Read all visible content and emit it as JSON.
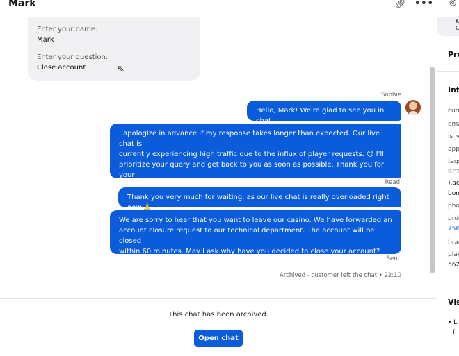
{
  "header": {
    "title": "Mark",
    "link_icon": "link-icon",
    "more_icon": "more-icon"
  },
  "form": {
    "name_label": "Enter your name:",
    "name_value": "Mark",
    "question_label": "Enter your question:",
    "question_value": "Close account"
  },
  "messages": {
    "sender": "Sophie",
    "m1": "Hello, Mark! We're glad to see you in chat.",
    "m2": "I apologize in advance if my response takes longer than expected. Our live chat is\ncurrently experiencing high traffic due to the influx of player requests. 😊 I'll\nprioritize your query and get back to you as soon as possible. Thank you for your\npatience! 😊",
    "read_status": "Read",
    "m3": "Thank you very much for waiting, as our live chat is really overloaded right now.🙏",
    "m4": "We are sorry to hear that you want to leave our casino. We have forwarded an\naccount closure request to our technical department. The account will be closed\nwithin 60 minutes. May I ask why have you decided to close your account?",
    "sent_status": "Sent",
    "archived_note": "Archived - customer left the chat • 22:10"
  },
  "footer": {
    "archived_text": "This chat has been archived.",
    "open_button": "Open chat"
  },
  "sidebar": {
    "card_line1": "K",
    "card_line2": "C",
    "pre_heading": "Pre",
    "inte_heading": "Inte",
    "fields": [
      "curr",
      "ema",
      "is_v",
      "app",
      "tags"
    ],
    "tags_value_1": "RET",
    "tags_value_2": "),ac",
    "tags_value_3": "bon",
    "phone_label": "pho",
    "profile_label": "prof",
    "profile_value": "756",
    "brand_label": "bran",
    "player_label": "play",
    "player_value": "562",
    "vis_heading": "Vis",
    "vis_item_1": "L",
    "vis_item_2": "("
  },
  "colors": {
    "accent": "#0b5cdb",
    "form_bg": "#f1f1f3",
    "muted": "#666666"
  }
}
